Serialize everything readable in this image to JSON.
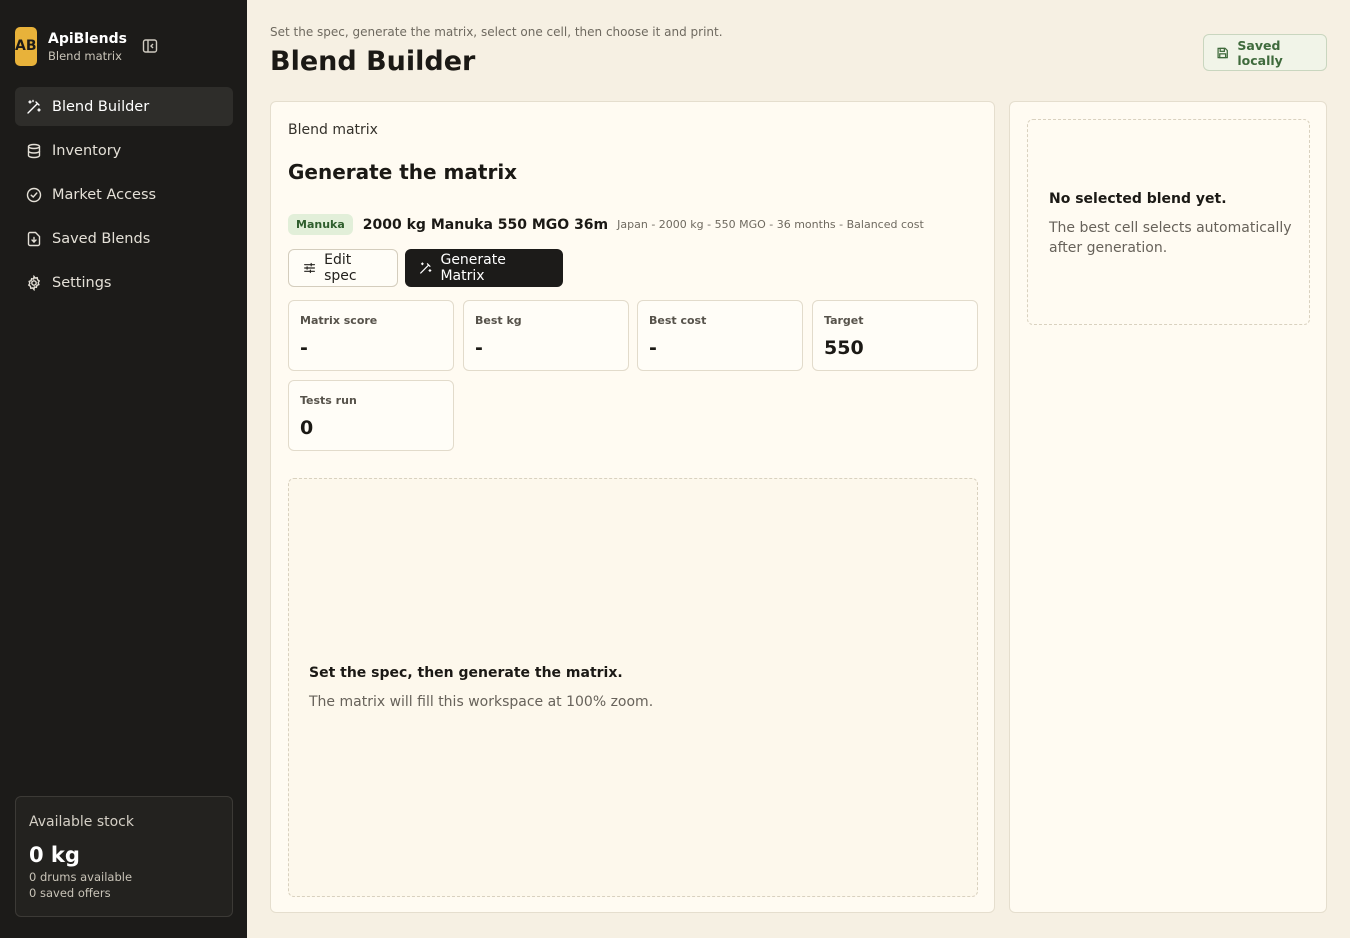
{
  "app": {
    "logo_text": "AB",
    "name": "ApiBlends",
    "subtitle": "Blend matrix"
  },
  "sidebar": {
    "items": [
      {
        "label": "Blend Builder",
        "icon": "magic-wand-icon",
        "active": true
      },
      {
        "label": "Inventory",
        "icon": "database-icon",
        "active": false
      },
      {
        "label": "Market Access",
        "icon": "check-circle-icon",
        "active": false
      },
      {
        "label": "Saved Blends",
        "icon": "file-download-icon",
        "active": false
      },
      {
        "label": "Settings",
        "icon": "gear-icon",
        "active": false
      }
    ],
    "stock": {
      "label": "Available stock",
      "value": "0 kg",
      "drums": "0 drums available",
      "offers": "0 saved offers"
    }
  },
  "header": {
    "hint": "Set the spec, generate the matrix, select one cell, then choose it and print.",
    "title": "Blend Builder",
    "saved_label": "Saved locally"
  },
  "main": {
    "label": "Blend matrix",
    "title": "Generate the matrix",
    "spec": {
      "chip": "Manuka",
      "name": "2000 kg Manuka 550 MGO 36m",
      "detail": "Japan - 2000 kg - 550 MGO - 36 months - Balanced cost"
    },
    "buttons": {
      "edit": "Edit spec",
      "generate": "Generate Matrix"
    },
    "stats": [
      {
        "label": "Matrix score",
        "value": "-"
      },
      {
        "label": "Best kg",
        "value": "-"
      },
      {
        "label": "Best cost",
        "value": "-"
      },
      {
        "label": "Target",
        "value": "550"
      },
      {
        "label": "Tests run",
        "value": "0"
      }
    ],
    "workspace": {
      "title": "Set the spec, then generate the matrix.",
      "text": "The matrix will fill this workspace at 100% zoom."
    }
  },
  "side": {
    "empty_title": "No selected blend yet.",
    "empty_text": "The best cell selects automatically after generation."
  },
  "colors": {
    "sidebar_bg": "#1c1b19",
    "page_bg": "#f6f0e3",
    "accent_logo": "#e8b23a",
    "saved_green": "#3f6a3c"
  }
}
